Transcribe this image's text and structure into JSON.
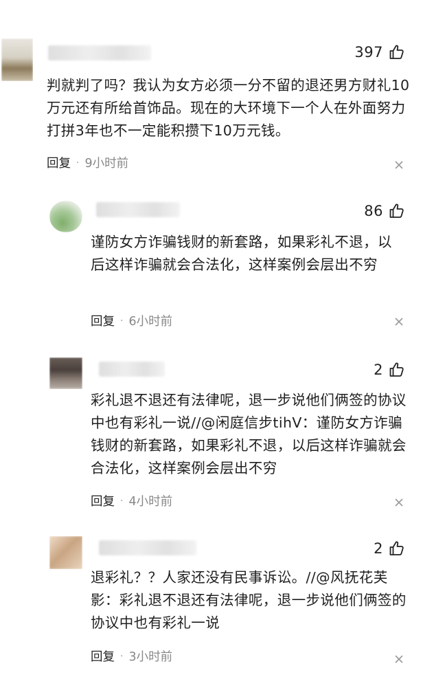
{
  "comments": [
    {
      "likes": "397",
      "text": "判就判了吗？我认为女方必须一分不留的退还男方财礼10万元还有所给首饰品。现在的大环境下一个人在外面努力打拼3年也不一定能积攒下10万元钱。",
      "reply_label": "回复",
      "time": "9小时前"
    },
    {
      "likes": "86",
      "text": "谨防女方诈骗钱财的新套路，如果彩礼不退，以后这样诈骗就会合法化，这样案例会层出不穷",
      "reply_label": "回复",
      "time": "6小时前"
    },
    {
      "likes": "2",
      "text": "彩礼退不退还有法律呢，退一步说他们俩签的协议中也有彩礼一说//@闲庭信步tihV：谨防女方诈骗钱财的新套路，如果彩礼不退，以后这样诈骗就会合法化，这样案例会层出不穷",
      "reply_label": "回复",
      "time": "4小时前"
    },
    {
      "likes": "2",
      "text": "退彩礼？？人家还没有民事诉讼。//@风抚花芙影：彩礼退不退还有法律呢，退一步说他们俩签的协议中也有彩礼一说",
      "reply_label": "回复",
      "time": "3小时前"
    }
  ],
  "icons": {
    "like": "thumbs-up-icon",
    "close": "close-icon"
  }
}
